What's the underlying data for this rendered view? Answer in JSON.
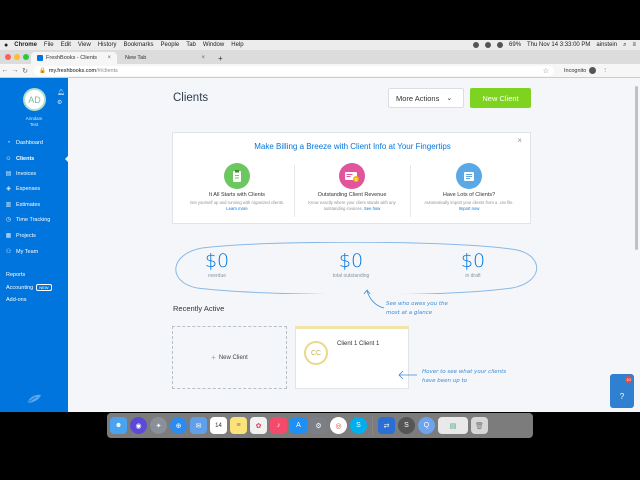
{
  "menubar": {
    "apple": "",
    "app": "Chrome",
    "items": [
      "File",
      "Edit",
      "View",
      "History",
      "Bookmarks",
      "People",
      "Tab",
      "Window",
      "Help"
    ],
    "battery": "69%",
    "datetime": "Thu Nov 14  3:33:00 PM",
    "user": "ainstein"
  },
  "browser": {
    "tabs": [
      {
        "title": "FreshBooks - Clients",
        "close": "×"
      },
      {
        "title": "New Tab",
        "close": "×"
      }
    ],
    "new_tab": "+",
    "url_host": "my.freshbooks.com",
    "url_path": "/#/clients",
    "incognito": "Incognito"
  },
  "sidebar": {
    "avatar_initials": "AD",
    "user_name": "Arindam",
    "user_sub": "Test",
    "items": [
      {
        "label": "Dashboard",
        "icon": "dashboard-icon"
      },
      {
        "label": "Clients",
        "icon": "clients-icon"
      },
      {
        "label": "Invoices",
        "icon": "invoices-icon"
      },
      {
        "label": "Expenses",
        "icon": "expenses-icon"
      },
      {
        "label": "Estimates",
        "icon": "estimates-icon"
      },
      {
        "label": "Time Tracking",
        "icon": "time-tracking-icon"
      },
      {
        "label": "Projects",
        "icon": "projects-icon"
      },
      {
        "label": "My Team",
        "icon": "team-icon"
      }
    ],
    "secondary": [
      {
        "label": "Reports"
      },
      {
        "label": "Accounting",
        "badge": "NEW"
      },
      {
        "label": "Add-ons"
      }
    ],
    "active": "Clients"
  },
  "main": {
    "title": "Clients",
    "more_actions": "More Actions",
    "new_client": "New Client",
    "promo": {
      "title": "Make Billing a Breeze with Client Info at Your Fingertips",
      "close": "×",
      "features": [
        {
          "title": "It All Starts with Clients",
          "desc": "Get yourself up and running with organized clients.",
          "link": "Learn more",
          "icon": "clipboard-icon",
          "color": "#6cc760"
        },
        {
          "title": "Outstanding Client Revenue",
          "desc": "Know exactly where your client stands with any outstanding invoices.",
          "link": "See how",
          "icon": "revenue-card-icon",
          "color": "#e0559b"
        },
        {
          "title": "Have Lots of Clients?",
          "desc": "Automatically import your clients from a .csv file.",
          "link": "Import now",
          "icon": "import-icon",
          "color": "#5aa9e6"
        }
      ]
    },
    "summary": [
      {
        "value": "$0",
        "label": "overdue"
      },
      {
        "value": "$0",
        "label": "total outstanding"
      },
      {
        "value": "$0",
        "label": "in draft"
      }
    ],
    "note_glance": [
      "See who owes you the",
      "most at a glance"
    ],
    "recent_title": "Recently Active",
    "new_client_card": "New Client",
    "client_card": {
      "initials": "CC",
      "name": "Client 1 Client 1"
    },
    "note_hover": [
      "Hover to see what your clients",
      "have been up to"
    ],
    "help": {
      "badge": "10",
      "symbol": "?"
    }
  },
  "dock": {
    "apps": [
      "finder",
      "siri",
      "launchpad",
      "safari",
      "mail",
      "calendar",
      "notes",
      "photos",
      "music",
      "app-store",
      "system-prefs",
      "chrome",
      "skype",
      "teamviewer",
      "screen-recorder",
      "quicktime",
      "preview",
      "trash"
    ],
    "calendar_day": "14"
  }
}
